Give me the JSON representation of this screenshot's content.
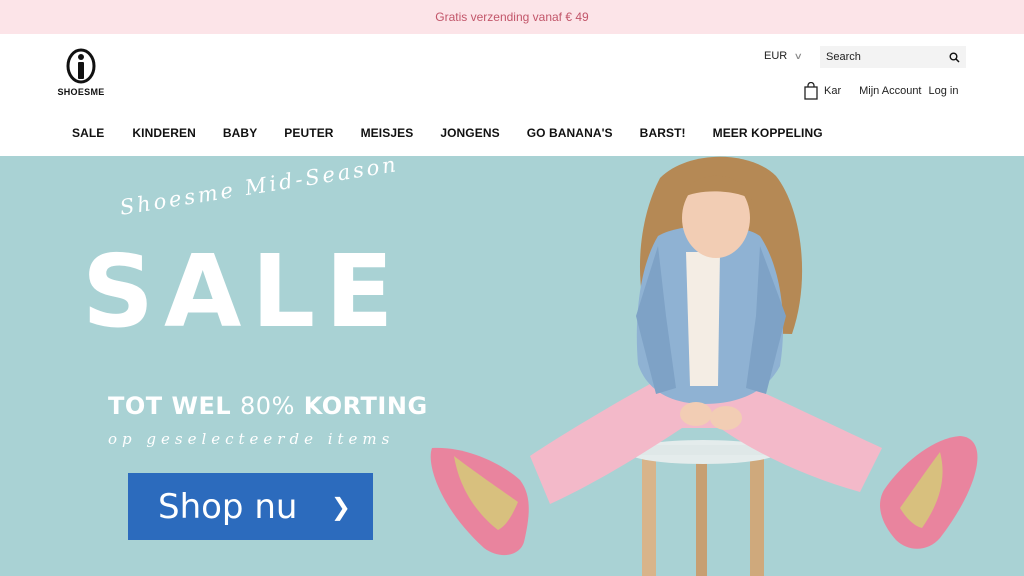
{
  "promo": {
    "text": "Gratis verzending vanaf € 49"
  },
  "brand": {
    "name": "SHOESME"
  },
  "header": {
    "currency": "EUR",
    "search_placeholder": "Search",
    "cart_label": "Kar",
    "account_label": "Mijn Account",
    "login_label": "Log in"
  },
  "nav": {
    "items": [
      "SALE",
      "KINDEREN",
      "BABY",
      "PEUTER",
      "MEISJES",
      "JONGENS",
      "GO BANANA'S",
      "BARST!",
      "MEER KOPPELING"
    ]
  },
  "hero": {
    "script_title": "Shoesme Mid-Season",
    "title": "SALE",
    "discount_prefix": "TOT WEL",
    "discount_pct": "80%",
    "discount_suffix": "KORTING",
    "subtitle": "op geselecteerde items",
    "cta_label": "Shop nu",
    "cta_icon": "chevron-right-icon",
    "background_color": "#a9d2d4",
    "cta_color": "#2c6bbd"
  },
  "colors": {
    "promo_bg": "#fce4e8",
    "promo_text": "#c2566a"
  }
}
